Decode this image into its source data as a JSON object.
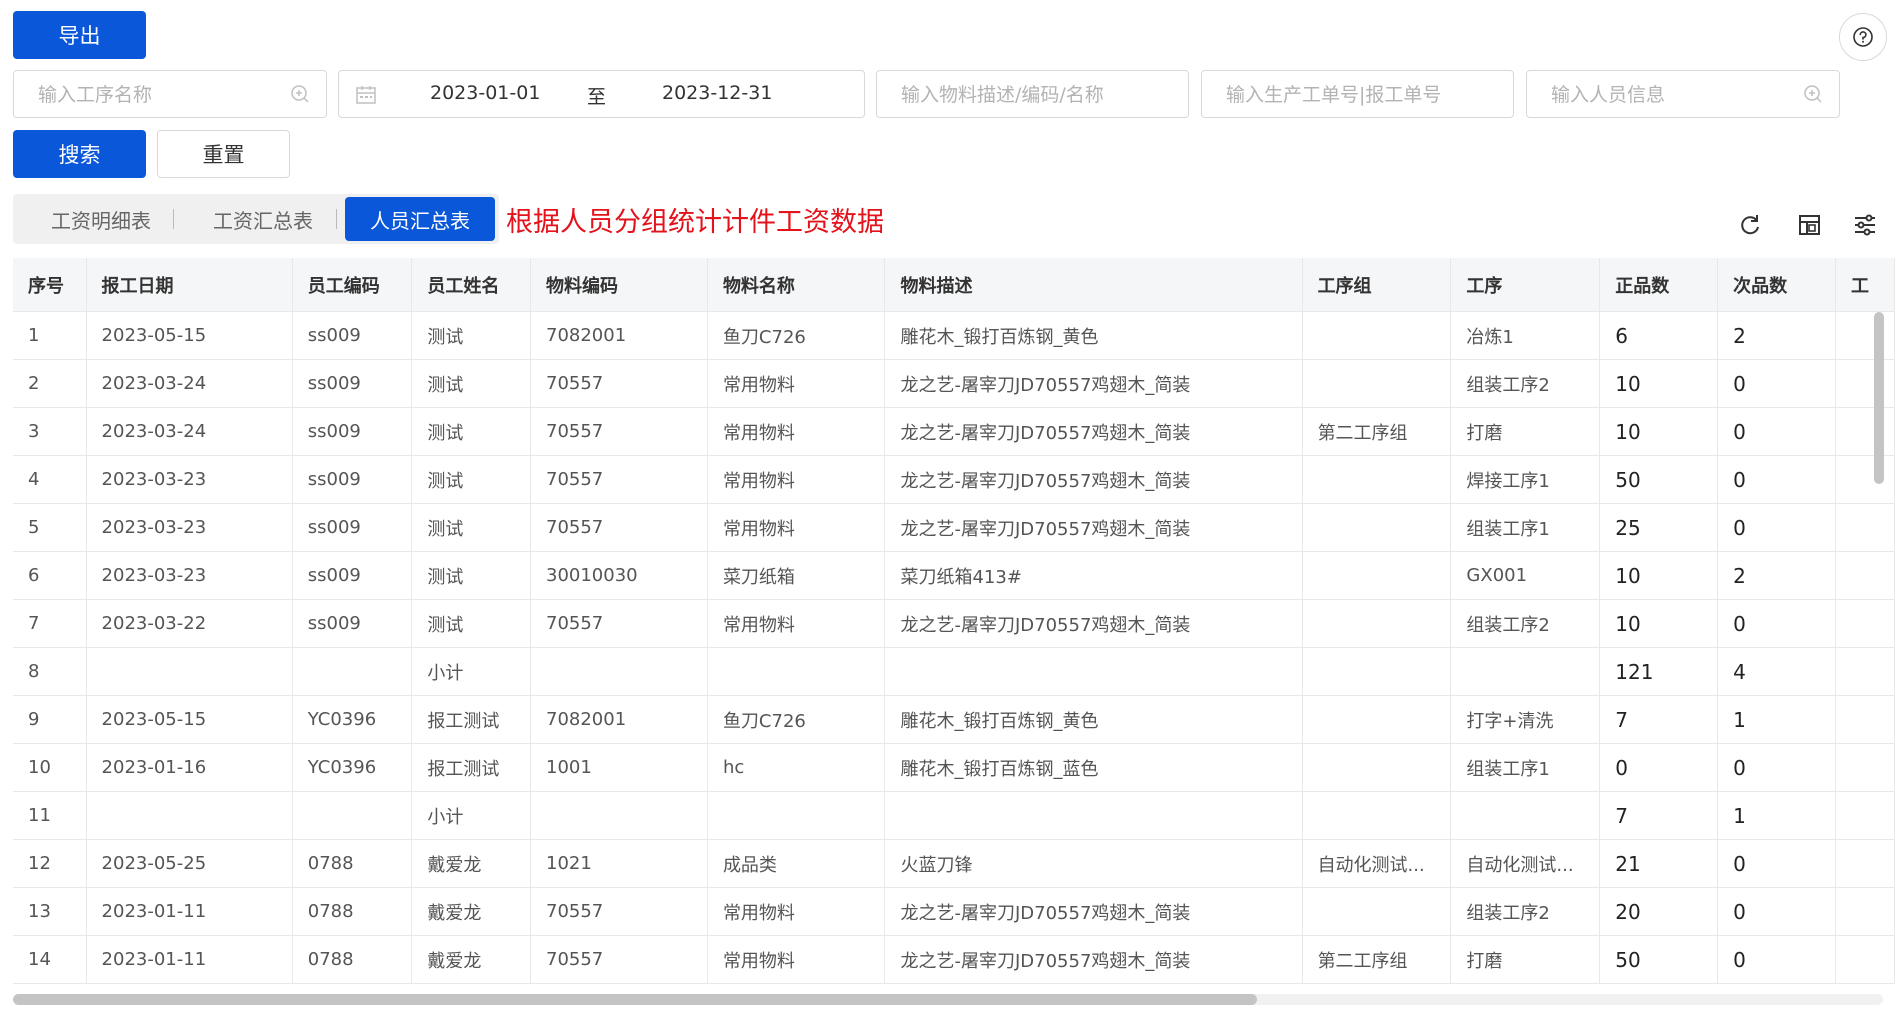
{
  "toolbar": {
    "export_label": "导出",
    "search_label": "搜索",
    "reset_label": "重置",
    "help_icon": "question-circle-icon"
  },
  "filters": {
    "process_placeholder": "输入工序名称",
    "date_start": "2023-01-01",
    "date_sep": "至",
    "date_end": "2023-12-31",
    "material_placeholder": "输入物料描述/编码/名称",
    "order_placeholder": "输入生产工单号|报工单号",
    "person_placeholder": "输入人员信息"
  },
  "tabs": [
    {
      "label": "工资明细表",
      "active": false
    },
    {
      "label": "工资汇总表",
      "active": false
    },
    {
      "label": "人员汇总表",
      "active": true
    }
  ],
  "annotation": "根据人员分组统计计件工资数据",
  "colors": {
    "primary": "#0b57d9",
    "annotation": "#e3121b"
  },
  "table": {
    "columns": [
      "序号",
      "报工日期",
      "员工编码",
      "员工姓名",
      "物料编码",
      "物料名称",
      "物料描述",
      "工序组",
      "工序",
      "正品数",
      "次品数",
      "工"
    ],
    "rows": [
      [
        "1",
        "2023-05-15",
        "ss009",
        "测试",
        "7082001",
        "鱼刀C726",
        "雕花木_锻打百炼钢_黄色",
        "",
        "冶炼1",
        "6",
        "2"
      ],
      [
        "2",
        "2023-03-24",
        "ss009",
        "测试",
        "70557",
        "常用物料",
        "龙之艺-屠宰刀JD70557鸡翅木_简装",
        "",
        "组装工序2",
        "10",
        "0"
      ],
      [
        "3",
        "2023-03-24",
        "ss009",
        "测试",
        "70557",
        "常用物料",
        "龙之艺-屠宰刀JD70557鸡翅木_简装",
        "第二工序组",
        "打磨",
        "10",
        "0"
      ],
      [
        "4",
        "2023-03-23",
        "ss009",
        "测试",
        "70557",
        "常用物料",
        "龙之艺-屠宰刀JD70557鸡翅木_简装",
        "",
        "焊接工序1",
        "50",
        "0"
      ],
      [
        "5",
        "2023-03-23",
        "ss009",
        "测试",
        "70557",
        "常用物料",
        "龙之艺-屠宰刀JD70557鸡翅木_简装",
        "",
        "组装工序1",
        "25",
        "0"
      ],
      [
        "6",
        "2023-03-23",
        "ss009",
        "测试",
        "30010030",
        "菜刀纸箱",
        "菜刀纸箱413#",
        "",
        "GX001",
        "10",
        "2"
      ],
      [
        "7",
        "2023-03-22",
        "ss009",
        "测试",
        "70557",
        "常用物料",
        "龙之艺-屠宰刀JD70557鸡翅木_简装",
        "",
        "组装工序2",
        "10",
        "0"
      ],
      [
        "8",
        "",
        "",
        "小计",
        "",
        "",
        "",
        "",
        "",
        "121",
        "4"
      ],
      [
        "9",
        "2023-05-15",
        "YC0396",
        "报工测试",
        "7082001",
        "鱼刀C726",
        "雕花木_锻打百炼钢_黄色",
        "",
        "打字+清洗",
        "7",
        "1"
      ],
      [
        "10",
        "2023-01-16",
        "YC0396",
        "报工测试",
        "1001",
        "hc",
        "雕花木_锻打百炼钢_蓝色",
        "",
        "组装工序1",
        "0",
        "0"
      ],
      [
        "11",
        "",
        "",
        "小计",
        "",
        "",
        "",
        "",
        "",
        "7",
        "1"
      ],
      [
        "12",
        "2023-05-25",
        "0788",
        "戴爱龙",
        "1021",
        "成品类",
        "火蓝刀锋",
        "自动化测试...",
        "自动化测试...",
        "21",
        "0"
      ],
      [
        "13",
        "2023-01-11",
        "0788",
        "戴爱龙",
        "70557",
        "常用物料",
        "龙之艺-屠宰刀JD70557鸡翅木_简装",
        "",
        "组装工序2",
        "20",
        "0"
      ],
      [
        "14",
        "2023-01-11",
        "0788",
        "戴爱龙",
        "70557",
        "常用物料",
        "龙之艺-屠宰刀JD70557鸡翅木_简装",
        "第二工序组",
        "打磨",
        "50",
        "0"
      ]
    ]
  }
}
